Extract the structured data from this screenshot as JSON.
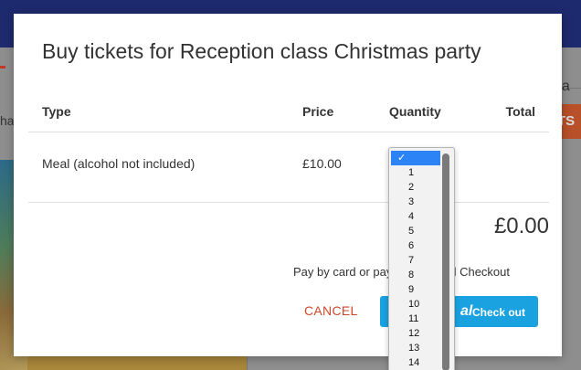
{
  "background": {
    "left_text": "hav",
    "right_text": "s pa",
    "orange_button": "TS"
  },
  "modal": {
    "title": "Buy tickets for Reception class Christmas party",
    "columns": {
      "type": "Type",
      "price": "Price",
      "quantity": "Quantity",
      "total": "Total"
    },
    "rows": [
      {
        "type": "Meal (alcohol not included)",
        "price": "£10.00"
      }
    ],
    "grand_total": "£0.00",
    "payment_note": "Pay by card or pay with Paypal Checkout",
    "cancel_label": "CANCEL",
    "paypal_mark": "al",
    "checkout_label": "Check out"
  },
  "quantity_select": {
    "selected_marker": "✓",
    "options": [
      "1",
      "2",
      "3",
      "4",
      "5",
      "6",
      "7",
      "8",
      "9",
      "10",
      "11",
      "12",
      "13",
      "14"
    ]
  },
  "colors": {
    "accent_blue": "#1aa2e0",
    "cancel_red": "#d0462d",
    "selected_option": "#2b83f6",
    "top_bar": "#1e2a6e"
  }
}
